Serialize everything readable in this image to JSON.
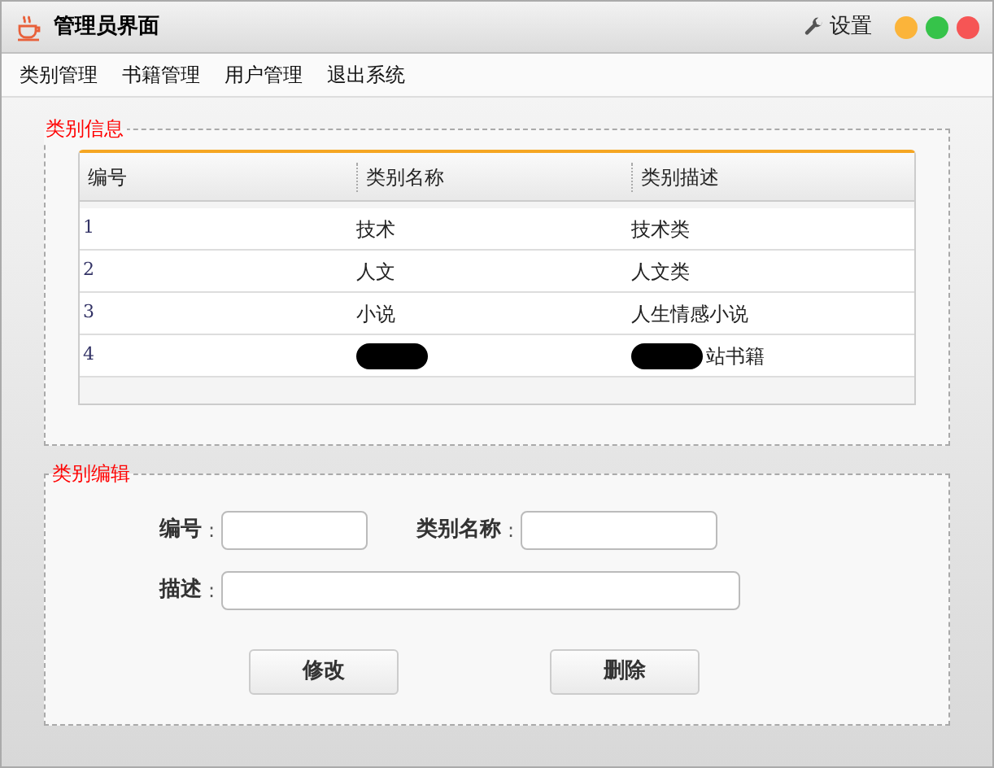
{
  "window": {
    "title": "管理员界面",
    "settings": "设置"
  },
  "menu": [
    "类别管理",
    "书籍管理",
    "用户管理",
    "退出系统"
  ],
  "info_panel": {
    "legend": "类别信息",
    "table": {
      "columns": [
        "编号",
        "类别名称",
        "类别描述"
      ],
      "rows": [
        {
          "cells": [
            {
              "text": "1",
              "redacted": false
            },
            {
              "text": "技术",
              "redacted": false
            },
            {
              "text": "技术类",
              "redacted": false
            }
          ]
        },
        {
          "cells": [
            {
              "text": "2",
              "redacted": false
            },
            {
              "text": "人文",
              "redacted": false
            },
            {
              "text": "人文类",
              "redacted": false
            }
          ]
        },
        {
          "cells": [
            {
              "text": "3",
              "redacted": false
            },
            {
              "text": "小说",
              "redacted": false
            },
            {
              "text": "人生情感小说",
              "redacted": false
            }
          ]
        },
        {
          "cells": [
            {
              "text": "4",
              "redacted": false
            },
            {
              "redacted": true
            },
            {
              "text": "站书籍",
              "redacted": true
            }
          ]
        }
      ]
    }
  },
  "edit_panel": {
    "legend": "类别编辑",
    "fields": [
      {
        "label": "编号",
        "colon": ":"
      },
      {
        "label": "类别名称",
        "colon": ":"
      },
      {
        "label": "描述",
        "colon": ":"
      }
    ],
    "buttons": [
      "修改",
      "删除"
    ]
  }
}
